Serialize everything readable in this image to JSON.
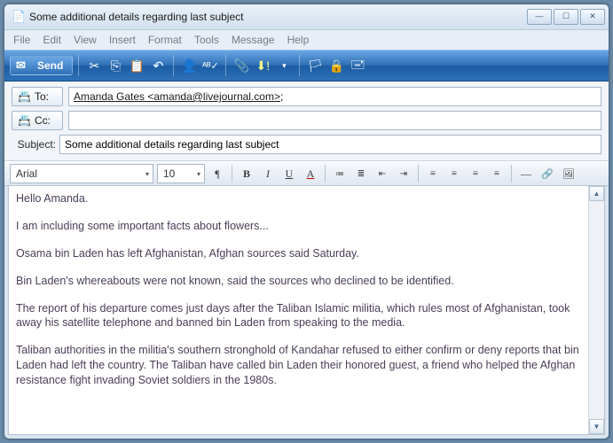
{
  "window": {
    "title": "Some additional details regarding last subject"
  },
  "menu": {
    "file": "File",
    "edit": "Edit",
    "view": "View",
    "insert": "Insert",
    "format": "Format",
    "tools": "Tools",
    "message": "Message",
    "help": "Help"
  },
  "toolbar": {
    "send_label": "Send"
  },
  "headers": {
    "to_label": "To:",
    "cc_label": "Cc:",
    "subject_label": "Subject:",
    "to_value": "Amanda Gates <amanda@livejournal.com>",
    "to_suffix": ";",
    "cc_value": "",
    "subject_value": "Some additional details regarding last subject"
  },
  "format": {
    "font": "Arial",
    "size": "10"
  },
  "body": {
    "p1": "Hello Amanda.",
    "p2": "I am including some important facts about flowers...",
    "p3": "Osama bin Laden has left Afghanistan, Afghan sources said Saturday.",
    "p4": "Bin Laden's whereabouts were not known, said the sources who declined to be identified.",
    "p5": "The report of his departure comes just days after the Taliban Islamic militia, which rules most of Afghanistan, took away his satellite telephone and banned bin Laden from speaking to the media.",
    "p6": "Taliban authorities in the militia's southern stronghold of Kandahar refused to either confirm or deny reports that bin Laden had left the country. The Taliban have called bin Laden their honored guest, a friend who helped the Afghan resistance fight invading Soviet soldiers in the 1980s."
  }
}
